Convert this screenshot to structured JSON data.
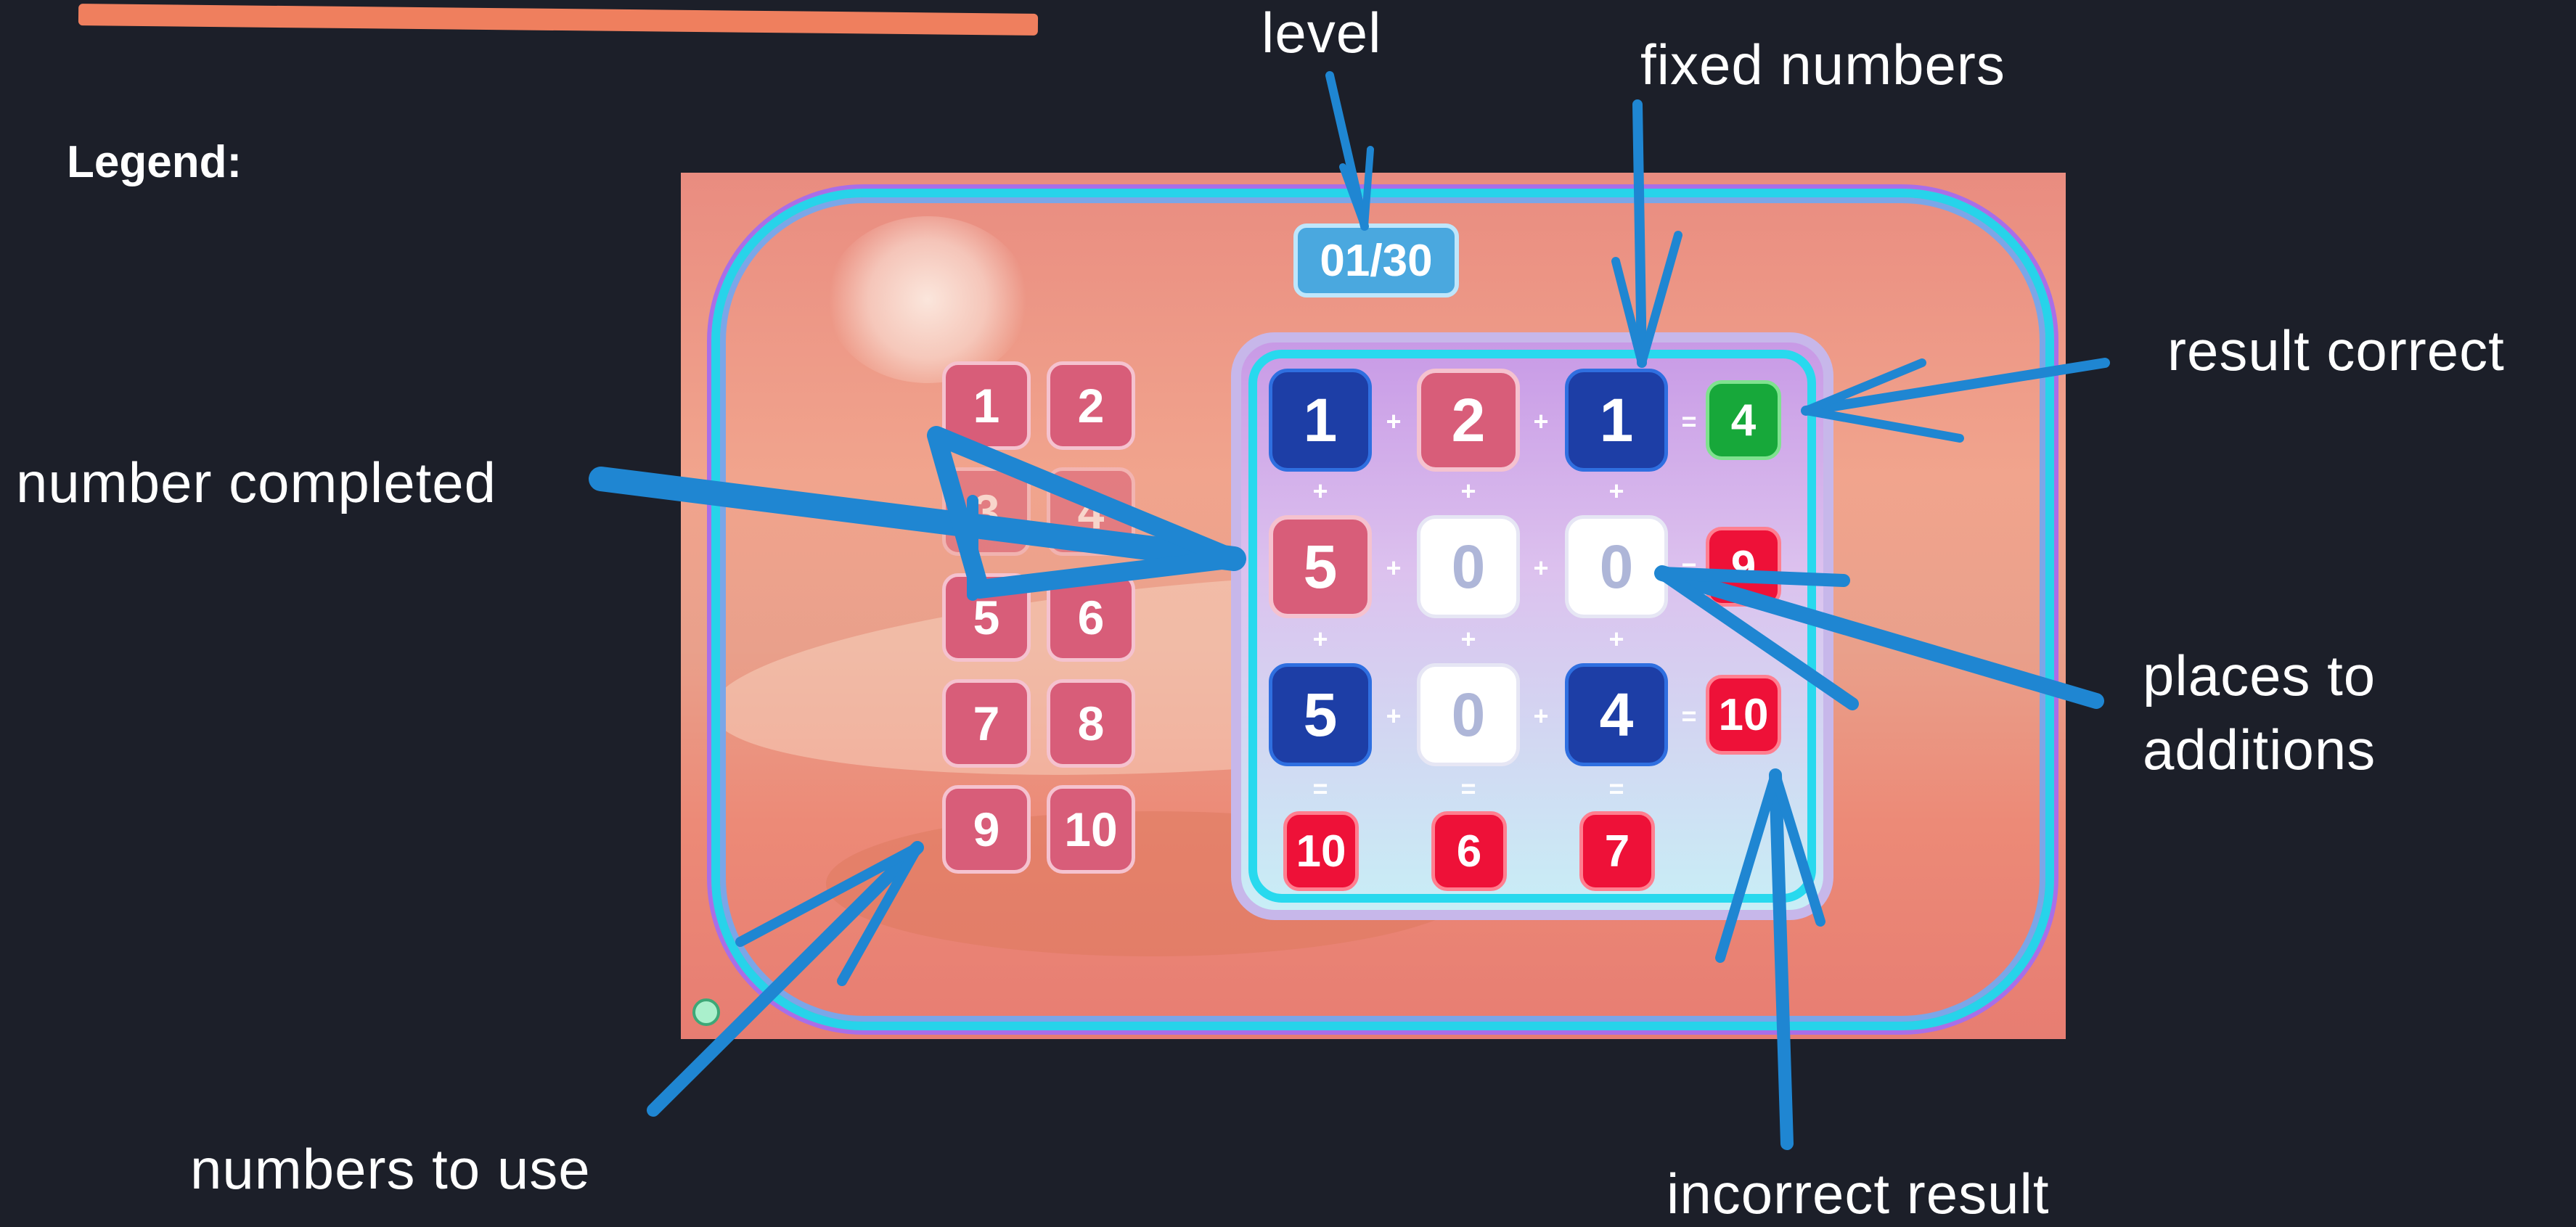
{
  "legend_title": "Legend:",
  "annotations": {
    "level": "level",
    "fixed_numbers": "fixed numbers",
    "result_correct": "result correct",
    "number_completed": "number completed",
    "places_to_additions": "places to additions",
    "numbers_to_use": "numbers to use",
    "incorrect_result": "incorrect result"
  },
  "game": {
    "level": "01/30",
    "tray_numbers": [
      "1",
      "2",
      "3",
      "4",
      "5",
      "6",
      "7",
      "8",
      "9",
      "10"
    ],
    "grid": [
      [
        {
          "v": "1",
          "kind": "fixed"
        },
        {
          "v": "2",
          "kind": "placed"
        },
        {
          "v": "1",
          "kind": "fixed"
        }
      ],
      [
        {
          "v": "5",
          "kind": "placed"
        },
        {
          "v": "0",
          "kind": "empty"
        },
        {
          "v": "0",
          "kind": "empty"
        }
      ],
      [
        {
          "v": "5",
          "kind": "fixed"
        },
        {
          "v": "0",
          "kind": "empty"
        },
        {
          "v": "4",
          "kind": "fixed"
        }
      ]
    ],
    "row_results": [
      "4",
      "9",
      "10"
    ],
    "col_results": [
      "10",
      "6",
      "7"
    ],
    "plus": "+",
    "equals": "=",
    "colors": {
      "fixed": "#1d3ea6",
      "placed": "#d85d79",
      "correct": "#17a83a",
      "incorrect": "#ee1138",
      "arrow": "#1f86d2"
    }
  }
}
